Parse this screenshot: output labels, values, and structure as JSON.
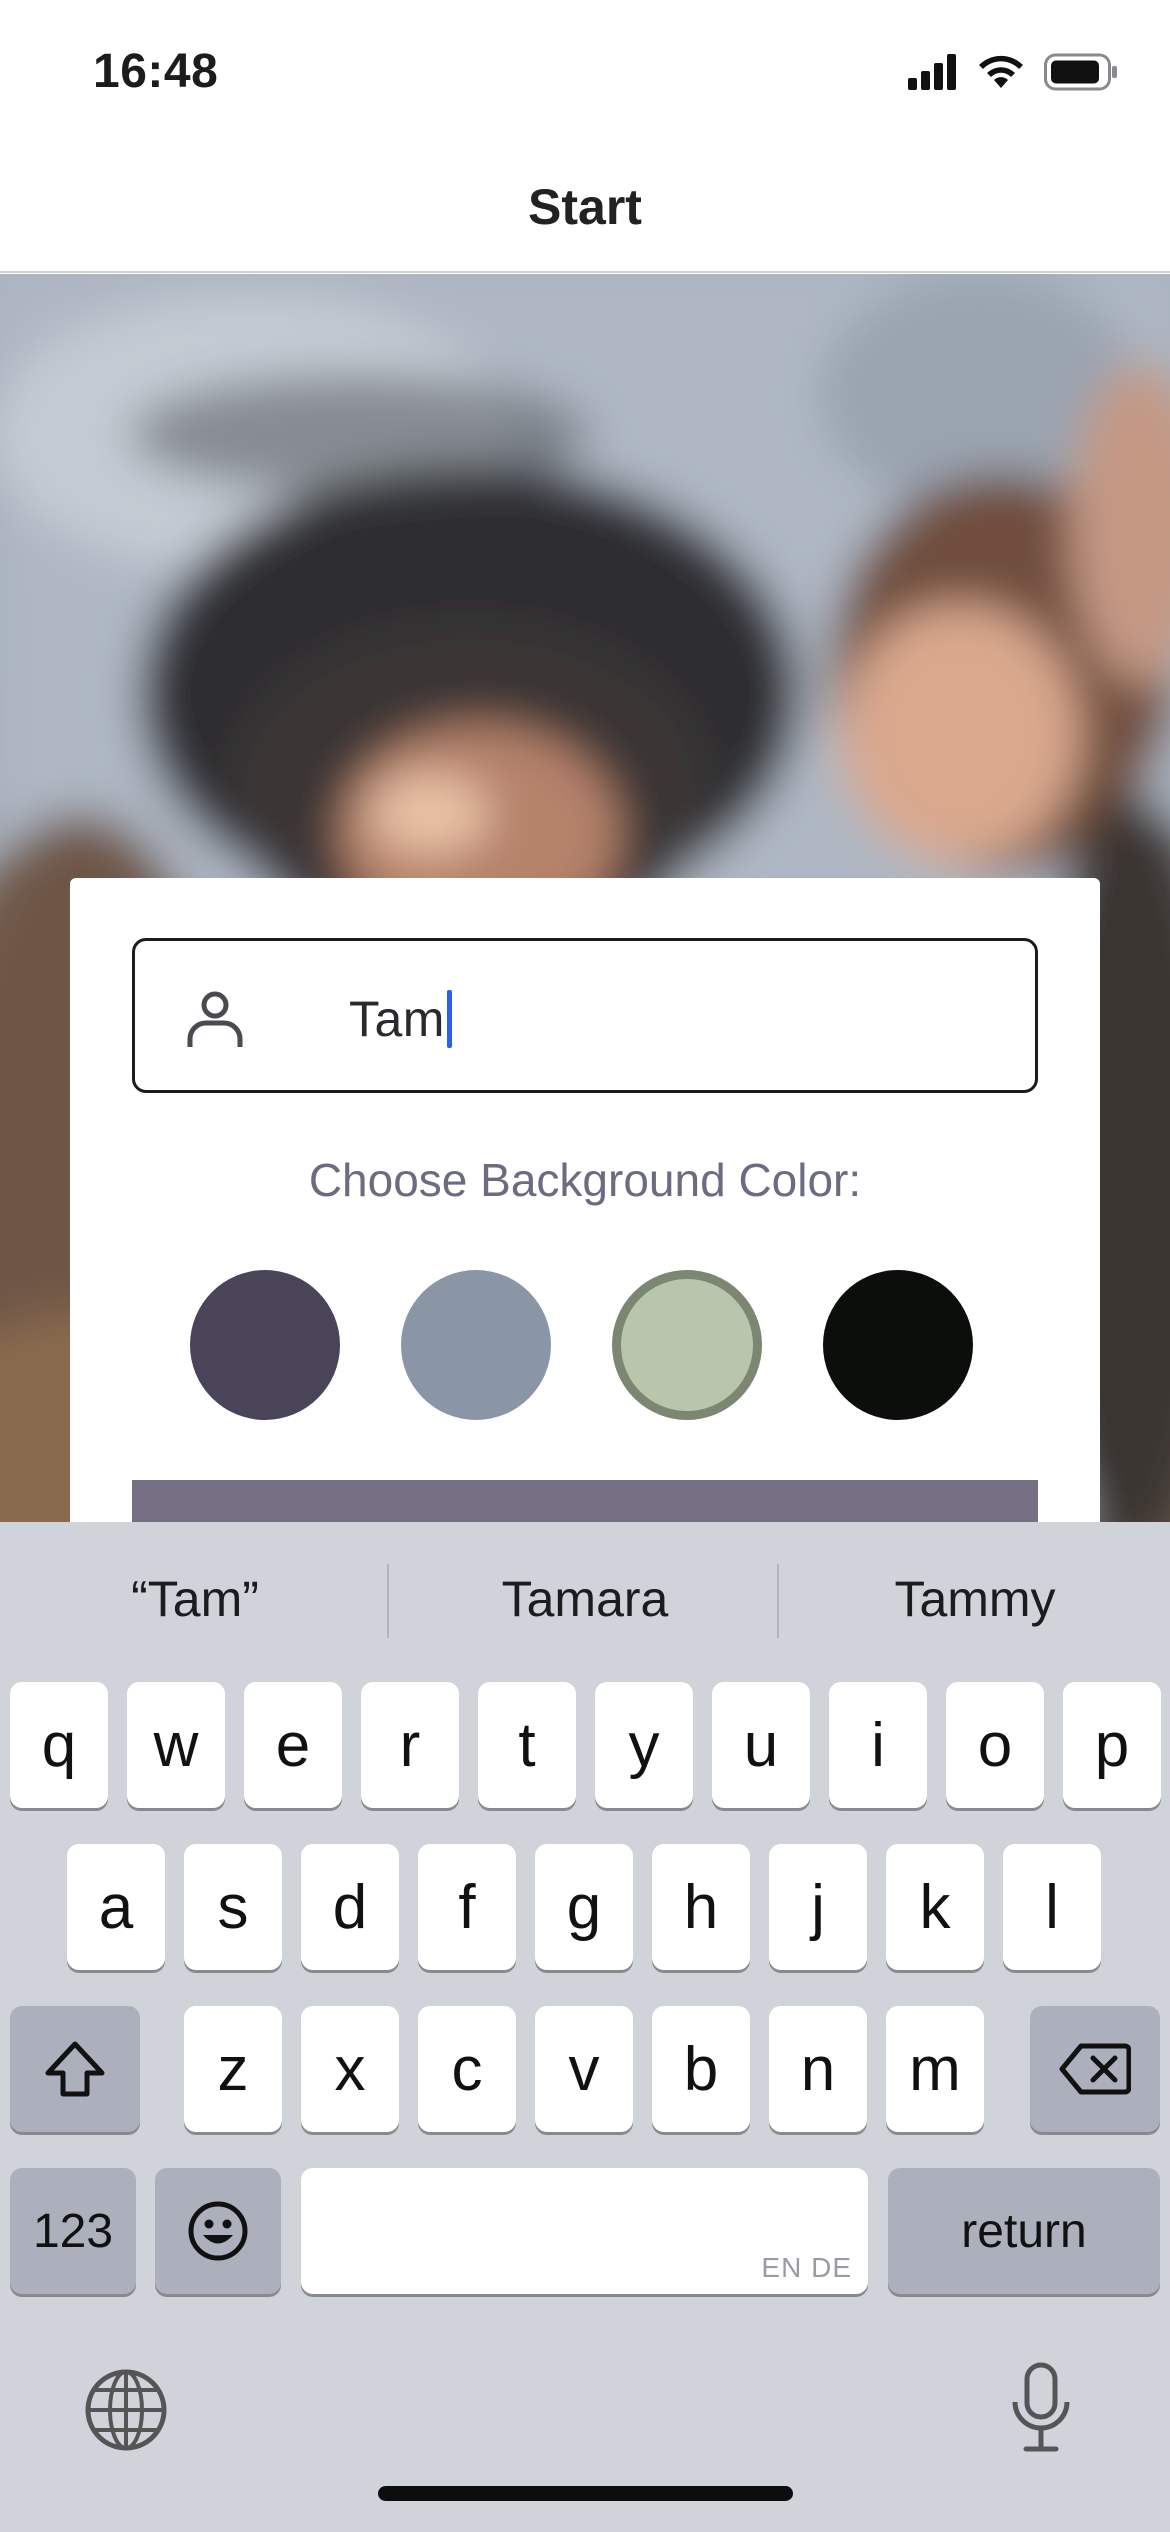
{
  "status_bar": {
    "time": "16:48",
    "icons": [
      "cellular-signal-icon",
      "wifi-icon",
      "battery-icon"
    ]
  },
  "nav": {
    "title": "Start"
  },
  "form": {
    "name_input": {
      "value": "Tam",
      "icon": "user-icon"
    },
    "color_label": "Choose Background Color:",
    "colors": [
      {
        "hex": "#4a4458",
        "selected": false
      },
      {
        "hex": "#8a95a5",
        "selected": false
      },
      {
        "hex": "#b9c6ae",
        "selected": true
      },
      {
        "hex": "#0b0e0a",
        "selected": false
      }
    ],
    "start_button_color": "#757083"
  },
  "keyboard": {
    "suggestions": [
      "“Tam”",
      "Tamara",
      "Tammy"
    ],
    "row1": [
      "q",
      "w",
      "e",
      "r",
      "t",
      "y",
      "u",
      "i",
      "o",
      "p"
    ],
    "row2": [
      "a",
      "s",
      "d",
      "f",
      "g",
      "h",
      "j",
      "k",
      "l"
    ],
    "row3": [
      "z",
      "x",
      "c",
      "v",
      "b",
      "n",
      "m"
    ],
    "numbers_key": "123",
    "return_key": "return",
    "space_hint": "EN DE",
    "icons": [
      "shift-icon",
      "backspace-icon",
      "emoji-icon",
      "globe-icon",
      "microphone-icon"
    ]
  }
}
